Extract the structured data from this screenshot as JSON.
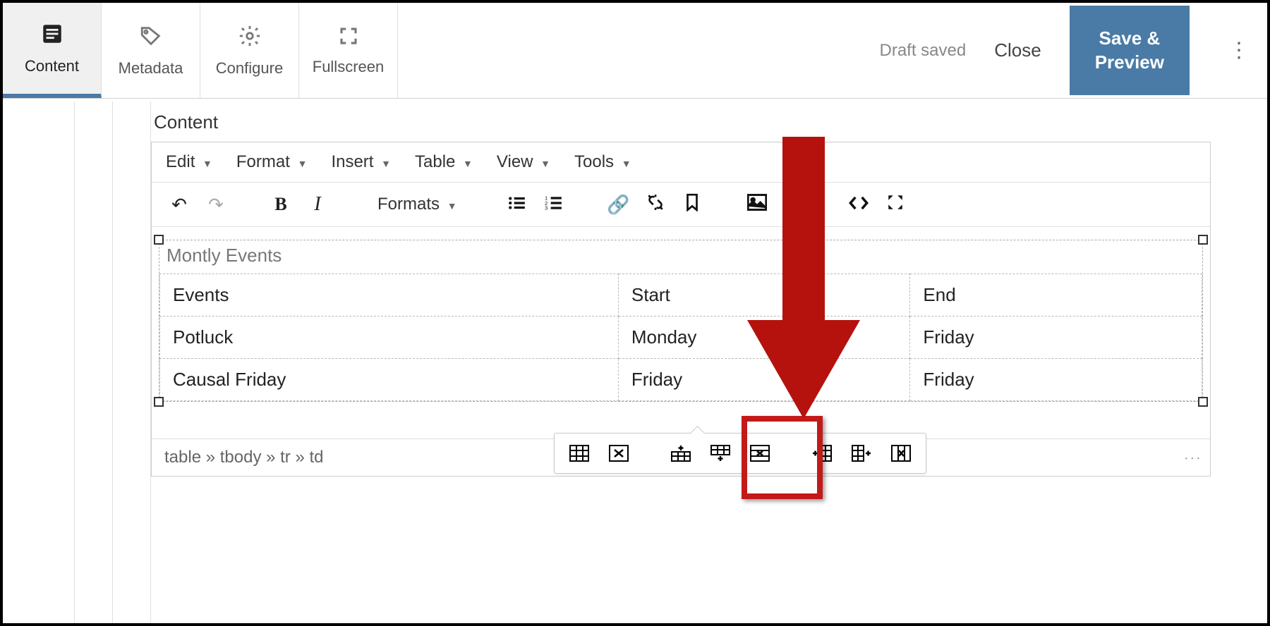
{
  "topbar": {
    "tabs": [
      {
        "label": "Content",
        "icon": "content-icon"
      },
      {
        "label": "Metadata",
        "icon": "tag-icon"
      },
      {
        "label": "Configure",
        "icon": "gear-icon"
      },
      {
        "label": "Fullscreen",
        "icon": "fullscreen-icon"
      }
    ],
    "draft_status": "Draft saved",
    "close_label": "Close",
    "save_label": "Save & Preview"
  },
  "section_label": "Content",
  "editor": {
    "menus": [
      "Edit",
      "Format",
      "Insert",
      "Table",
      "View",
      "Tools"
    ],
    "formats_label": "Formats",
    "path": "table » tbody » tr » td",
    "table": {
      "caption": "Montly Events",
      "rows": [
        [
          "Events",
          "Start",
          "End"
        ],
        [
          "Potluck",
          "Monday",
          "Friday"
        ],
        [
          "Causal Friday",
          "Friday",
          "Friday"
        ]
      ]
    },
    "context_toolbar": [
      "table-properties",
      "delete-table",
      "insert-row-before",
      "insert-row-after",
      "delete-row",
      "insert-col-before",
      "insert-col-after",
      "delete-col"
    ]
  },
  "colors": {
    "accent": "#4a7ba6",
    "annotation": "#c21a1a"
  }
}
